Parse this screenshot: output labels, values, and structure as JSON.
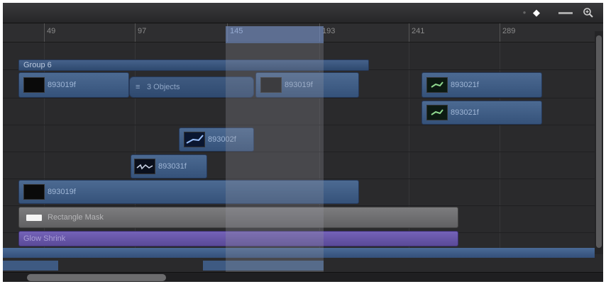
{
  "toolbar": {
    "icons": [
      "keyframe-diamond-icon",
      "view-toggle-icon",
      "zoom-icon"
    ],
    "diamond_glyph": "◆",
    "toggle_glyph": "▬▬",
    "zoom_glyph": "🔍"
  },
  "ruler": {
    "ticks": [
      "49",
      "97",
      "145",
      "193",
      "241",
      "289"
    ]
  },
  "tracks": {
    "group_label": "Group 6",
    "objects_label": "3 Objects",
    "clips": {
      "c1": "893019f",
      "c2": "893019f",
      "c3": "893021f",
      "c4": "893021f",
      "c5": "893002f",
      "c6": "893031f",
      "c7": "893019f",
      "mask": "Rectangle Mask",
      "glow": "Glow Shrink"
    }
  },
  "colors": {
    "clip": "#4c6a92",
    "mask": "#7a7a7c",
    "glow": "#6a5aa8",
    "range": "#6e8cc8"
  }
}
